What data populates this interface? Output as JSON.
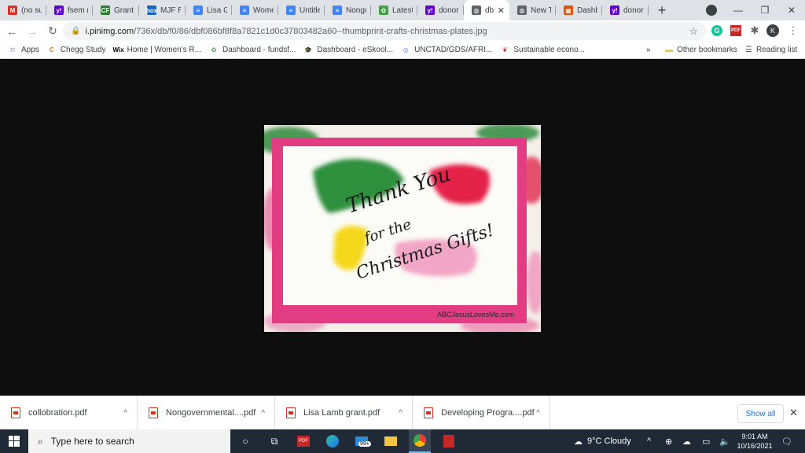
{
  "tabs": [
    {
      "title": "(no sub",
      "icon": "gmail-icon",
      "color": "#d93025",
      "glyph": "M"
    },
    {
      "title": "fsem m",
      "icon": "yahoo-icon",
      "color": "#6001d2",
      "glyph": "y!"
    },
    {
      "title": "Grant C",
      "icon": "cf-icon",
      "color": "#2e7d32",
      "glyph": "CF"
    },
    {
      "title": "MJF Ra",
      "icon": "box-icon",
      "color": "#1565c0",
      "glyph": "box"
    },
    {
      "title": "Lisa GR",
      "icon": "docs-icon",
      "color": "#4285f4",
      "glyph": "≡"
    },
    {
      "title": "Women",
      "icon": "docs-icon",
      "color": "#4285f4",
      "glyph": "≡"
    },
    {
      "title": "Untitle",
      "icon": "docs-icon",
      "color": "#4285f4",
      "glyph": "≡"
    },
    {
      "title": "Nongo",
      "icon": "docs-icon",
      "color": "#4285f4",
      "glyph": "≡"
    },
    {
      "title": "Latest",
      "icon": "leaf-icon",
      "color": "#43a047",
      "glyph": "✿"
    },
    {
      "title": "donor",
      "icon": "yahoo-icon",
      "color": "#6001d2",
      "glyph": "y!"
    },
    {
      "title": "dbf",
      "icon": "globe-icon",
      "color": "#5f6368",
      "glyph": "◍",
      "active": true
    },
    {
      "title": "New Ta",
      "icon": "globe-icon",
      "color": "#5f6368",
      "glyph": "◍"
    },
    {
      "title": "Dashb",
      "icon": "dashboard-icon",
      "color": "#e65100",
      "glyph": "▦"
    },
    {
      "title": "donor",
      "icon": "yahoo-icon",
      "color": "#6001d2",
      "glyph": "y!"
    }
  ],
  "toolbar": {
    "url_host": "i.pinimg.com",
    "url_path": "/736x/db/f0/86/dbf086bf8f8a7821c1d0c37803482a60--thumbprint-crafts-christmas-plates.jpg",
    "profile_initial": "K"
  },
  "bookmarks": [
    {
      "label": "Apps",
      "icon": "apps-grid-icon"
    },
    {
      "label": "Chegg Study",
      "icon": "chegg-icon"
    },
    {
      "label": "Home | Women's R...",
      "icon": "wix-icon"
    },
    {
      "label": "Dashboard - fundsf...",
      "icon": "leaf-icon"
    },
    {
      "label": "Dashboard - eSkool...",
      "icon": "graduation-cap-icon"
    },
    {
      "label": "UNCTAD/GDS/AFRI...",
      "icon": "un-icon"
    },
    {
      "label": "Sustainable econo...",
      "icon": "sustainable-icon"
    }
  ],
  "bookmarks_right": {
    "overflow": "»",
    "other": "Other bookmarks",
    "reading": "Reading list"
  },
  "photo": {
    "line1": "Thank You",
    "line2": "for the",
    "line3": "Christmas Gifts!",
    "credit": "ABCJesusLovesMe.com"
  },
  "downloads": [
    {
      "name": "collobration.pdf"
    },
    {
      "name": "Nongovernmental....pdf"
    },
    {
      "name": "Lisa Lamb grant.pdf"
    },
    {
      "name": "Developing Progra....pdf"
    }
  ],
  "downloads_bar": {
    "show_all": "Show all"
  },
  "taskbar": {
    "search_placeholder": "Type here to search",
    "weather": "9°C  Cloudy",
    "time": "9:01 AM",
    "date": "10/16/2021",
    "mail_badge": "99+"
  }
}
